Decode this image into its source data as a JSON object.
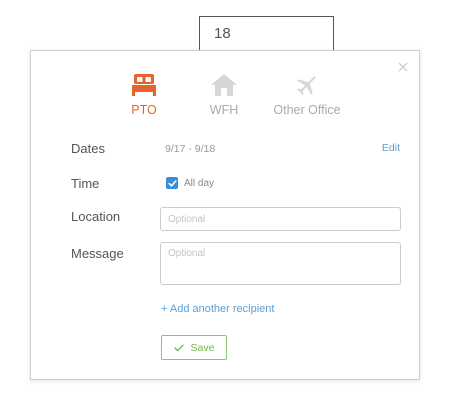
{
  "calendar": {
    "day_number": "18"
  },
  "dialog": {
    "types": [
      {
        "label": "PTO",
        "icon": "bed-icon",
        "active": true
      },
      {
        "label": "WFH",
        "icon": "home-icon",
        "active": false
      },
      {
        "label": "Other Office",
        "icon": "airplane-icon",
        "active": false
      }
    ],
    "labels": {
      "dates": "Dates",
      "time": "Time",
      "location": "Location",
      "message": "Message"
    },
    "dates_value": "9/17 - 9/18",
    "edit_label": "Edit",
    "all_day": {
      "label": "All day",
      "checked": true
    },
    "location_placeholder": "Optional",
    "message_placeholder": "Optional",
    "add_recipient_label": "+ Add another recipient",
    "save_label": "Save"
  },
  "colors": {
    "accent_active": "#e8632b",
    "link": "#5b9fd6",
    "checkbox": "#3a8ed8",
    "save_green": "#6fb84a",
    "icon_inactive": "#d6d6d6"
  }
}
